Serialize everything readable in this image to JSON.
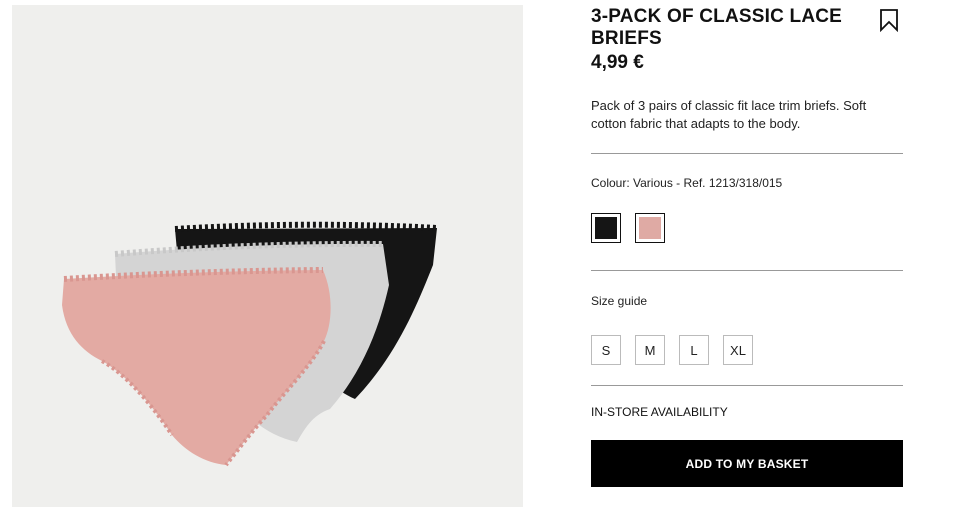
{
  "product": {
    "title": "3-PACK OF CLASSIC LACE BRIEFS",
    "price": "4,99 €",
    "description": "Pack of 3 pairs of classic fit lace trim briefs. Soft cotton fabric that adapts to the body.",
    "colour_line": "Colour: Various - Ref. 1213/318/015",
    "colours": [
      {
        "name": "black",
        "hex": "#151515"
      },
      {
        "name": "pink",
        "hex": "#dfaaa4"
      }
    ],
    "size_guide_label": "Size guide",
    "sizes": [
      "S",
      "M",
      "L",
      "XL"
    ],
    "availability_label": "IN-STORE AVAILABILITY",
    "add_to_basket_label": "ADD TO MY BASKET"
  },
  "icons": {
    "wishlist": "bookmark-icon"
  },
  "colors": {
    "button_bg": "#000000",
    "image_bg": "#efefed",
    "brief_black": "#151515",
    "brief_grey": "#d4d4d4",
    "brief_pink": "#e3aaa3"
  }
}
